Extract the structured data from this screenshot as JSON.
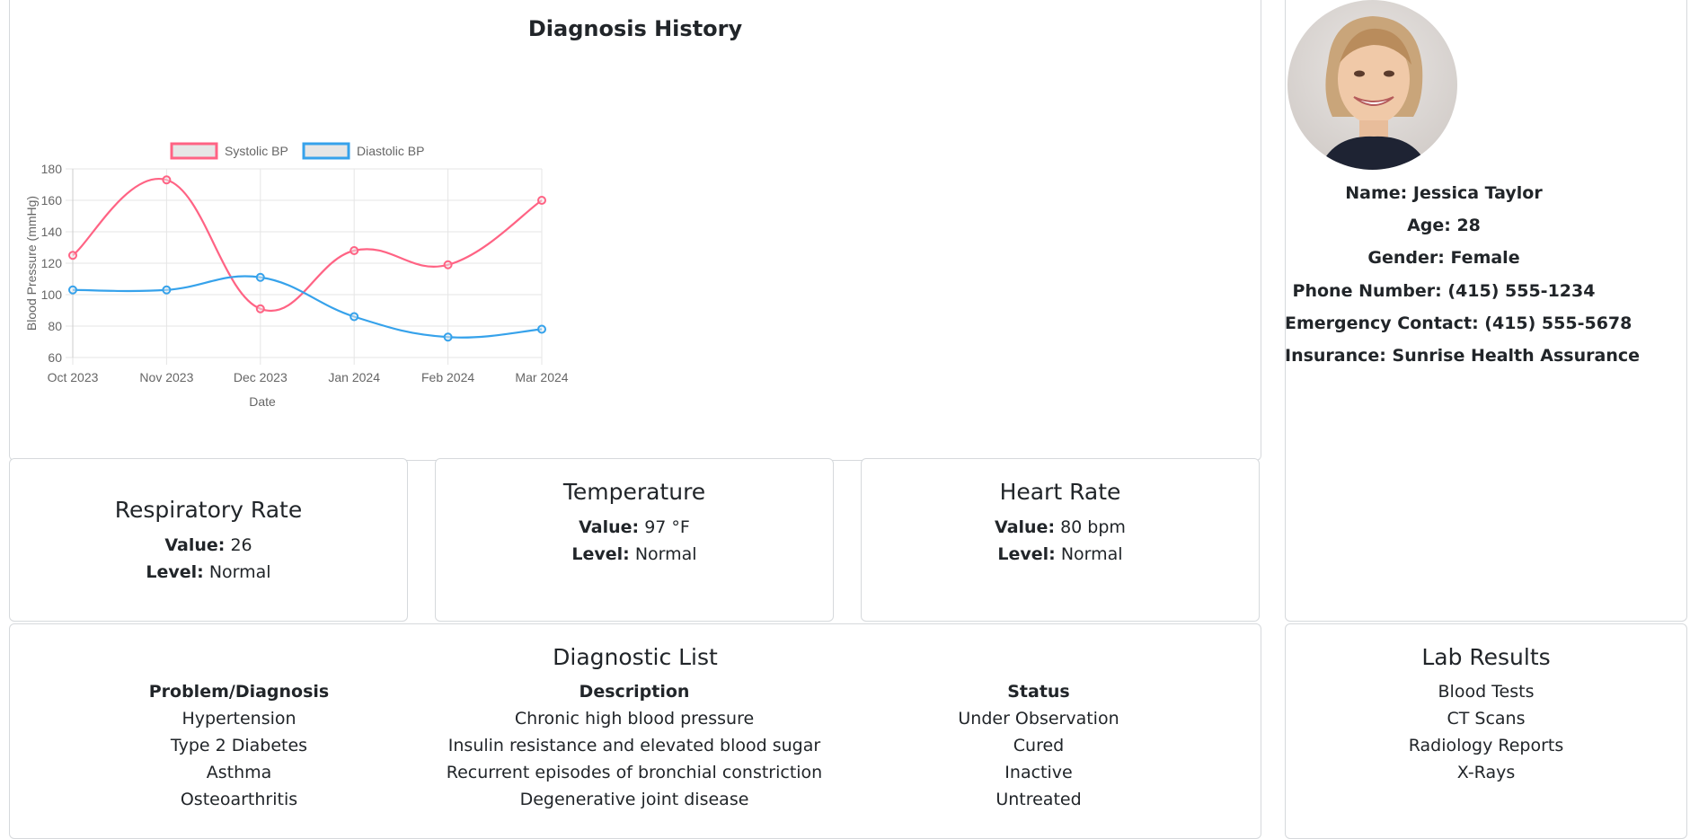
{
  "diagnosis_history": {
    "title": "Diagnosis History"
  },
  "chart_data": {
    "type": "line",
    "x": [
      "Oct 2023",
      "Nov 2023",
      "Dec 2023",
      "Jan 2024",
      "Feb 2024",
      "Mar 2024"
    ],
    "xlabel": "Date",
    "ylabel": "Blood Pressure (mmHg)",
    "ylim": [
      60,
      180
    ],
    "yticks": [
      60,
      80,
      100,
      120,
      140,
      160,
      180
    ],
    "grid": true,
    "legend": "top",
    "series": [
      {
        "name": "Systolic BP",
        "values": [
          125,
          173,
          91,
          128,
          119,
          160
        ],
        "color": "#ff6384"
      },
      {
        "name": "Diastolic BP",
        "values": [
          103,
          103,
          111,
          86,
          73,
          78
        ],
        "color": "#36a2eb"
      }
    ]
  },
  "vitals": [
    {
      "title": "Respiratory Rate",
      "value_label": "Value:",
      "value": "26",
      "level_label": "Level:",
      "level": "Normal"
    },
    {
      "title": "Temperature",
      "value_label": "Value:",
      "value": "97 °F",
      "level_label": "Level:",
      "level": "Normal"
    },
    {
      "title": "Heart Rate",
      "value_label": "Value:",
      "value": "80 bpm",
      "level_label": "Level:",
      "level": "Normal"
    }
  ],
  "profile": {
    "name": "Name: Jessica Taylor",
    "age": "Age: 28",
    "gender": "Gender: Female",
    "phone": "Phone Number: (415) 555-1234",
    "emergency": "Emergency Contact: (415) 555-5678",
    "insurance": "Insurance: Sunrise Health Assurance"
  },
  "diagnostic_list": {
    "title": "Diagnostic List",
    "headers": [
      "Problem/Diagnosis",
      "Description",
      "Status"
    ],
    "rows": [
      [
        "Hypertension",
        "Chronic high blood pressure",
        "Under Observation"
      ],
      [
        "Type 2 Diabetes",
        "Insulin resistance and elevated blood sugar",
        "Cured"
      ],
      [
        "Asthma",
        "Recurrent episodes of bronchial constriction",
        "Inactive"
      ],
      [
        "Osteoarthritis",
        "Degenerative joint disease",
        "Untreated"
      ]
    ]
  },
  "lab_results": {
    "title": "Lab Results",
    "items": [
      "Blood Tests",
      "CT Scans",
      "Radiology Reports",
      "X-Rays"
    ]
  }
}
